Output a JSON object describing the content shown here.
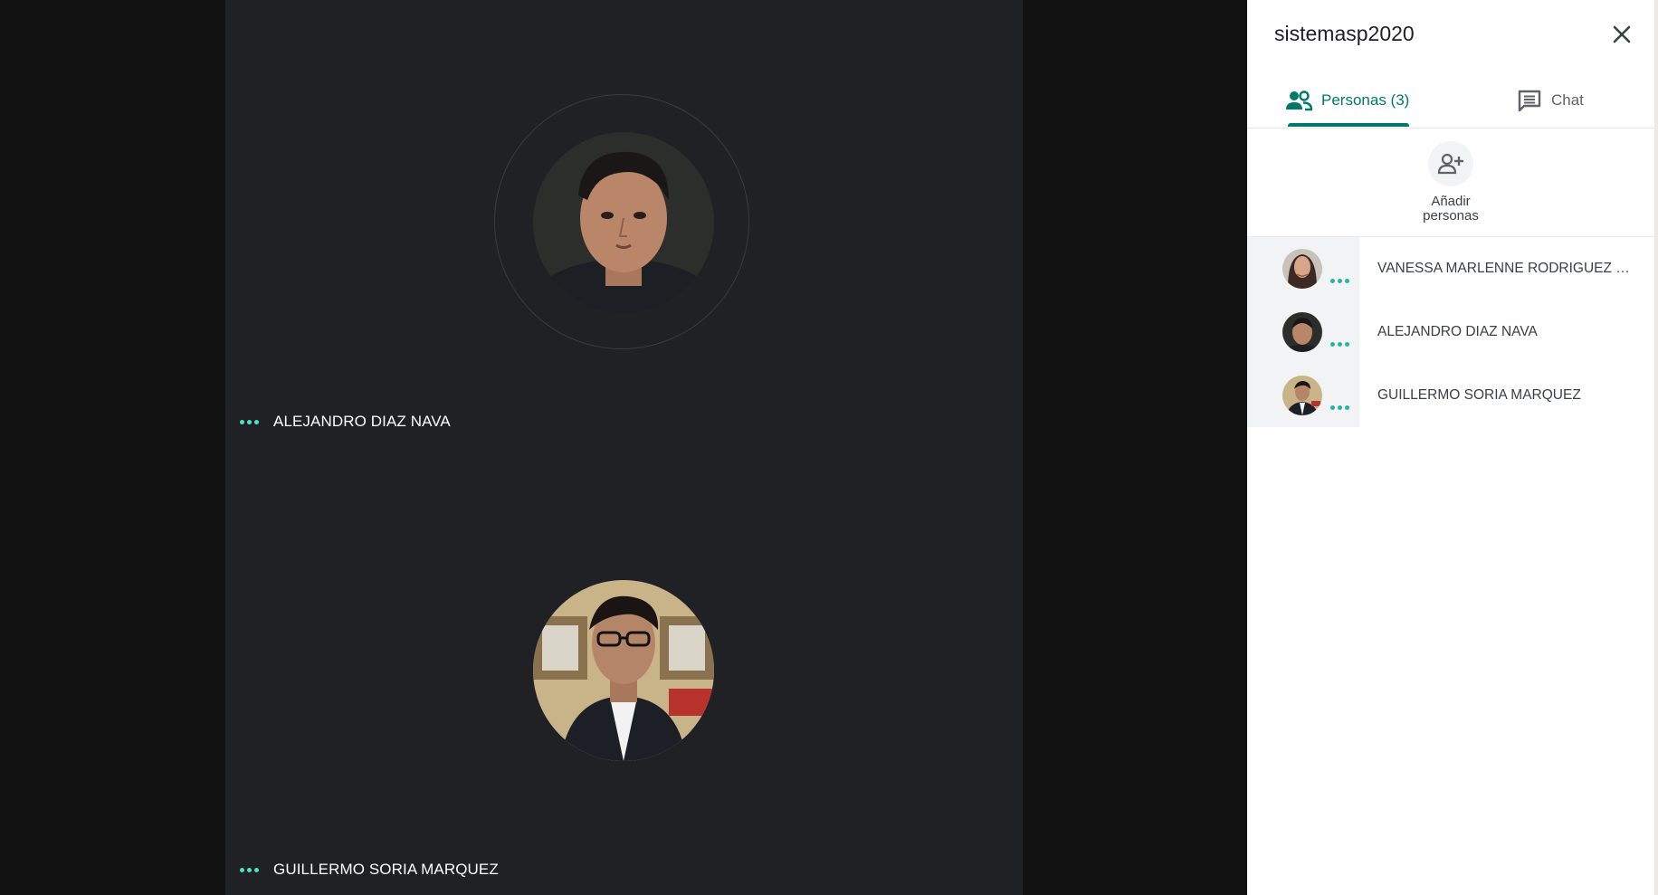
{
  "meeting": {
    "title": "sistemasp2020"
  },
  "tiles": [
    {
      "name": "ALEJANDRO DIAZ NAVA"
    },
    {
      "name": "GUILLERMO SORIA MARQUEZ"
    }
  ],
  "panel": {
    "tabs": {
      "people_label": "Personas (3)",
      "chat_label": "Chat"
    },
    "add_people_label_line1": "Añadir",
    "add_people_label_line2": "personas",
    "people": [
      {
        "name": "VANESSA MARLENNE RODRIGUEZ B..."
      },
      {
        "name": "ALEJANDRO DIAZ NAVA"
      },
      {
        "name": "GUILLERMO SORIA MARQUEZ"
      }
    ]
  },
  "colors": {
    "accent": "#00796b",
    "speaking_dots": "#4ee0c8",
    "stage_bg": "#202124",
    "page_bg": "#121212"
  },
  "icons": {
    "close": "close-icon",
    "people": "people-icon",
    "chat": "chat-icon",
    "add_person": "add-person-icon"
  }
}
